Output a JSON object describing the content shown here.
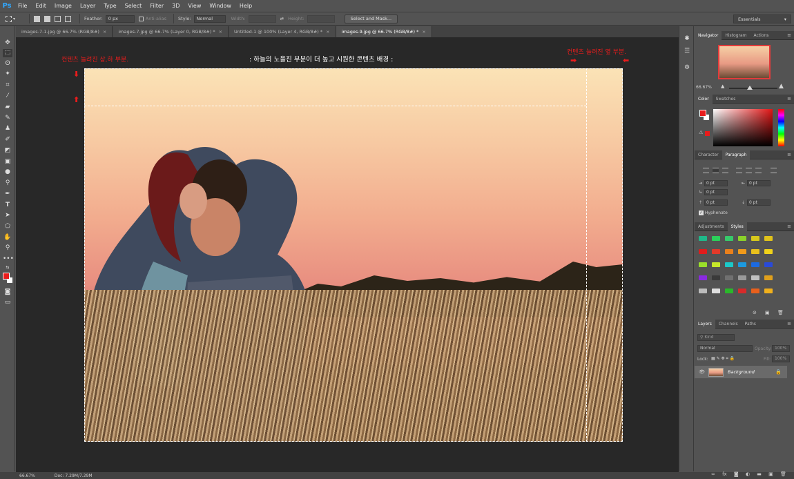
{
  "menu": {
    "logo": "Ps",
    "items": [
      "File",
      "Edit",
      "Image",
      "Layer",
      "Type",
      "Select",
      "Filter",
      "3D",
      "View",
      "Window",
      "Help"
    ]
  },
  "options": {
    "feather_label": "Feather:",
    "feather_value": "0 px",
    "antialias_label": "Anti-alias",
    "style_label": "Style:",
    "style_value": "Normal",
    "width_label": "Width:",
    "height_label": "Height:",
    "select_mask_label": "Select and Mask...",
    "workspace": "Essentials"
  },
  "tabs": [
    {
      "label": "images-7-1.jpg @ 66.7% (RGB/8#)",
      "close": "×"
    },
    {
      "label": "images-7.jpg @ 66.7% (Layer 0, RGB/8#) *",
      "close": "×"
    },
    {
      "label": "Untitled-1 @ 100% (Layer 4, RGB/8#) *",
      "close": "×"
    },
    {
      "label": "images-9.jpg @ 66.7% (RGB/8#) *",
      "close": "×"
    }
  ],
  "canvas": {
    "annotation_top_left": "컨텐츠 늘려진 상,하 부분.",
    "annotation_top_right": "컨텐츠 늘려진 옆 부분.",
    "center_note": ": 하늘의 노을진 부분이 더 높고 시원한 콘텐츠 배경 :"
  },
  "status": {
    "zoom": "66.67%",
    "doc": "Doc: 7.29M/7.29M"
  },
  "navigator": {
    "tabs": [
      "Navigator",
      "Histogram",
      "Actions"
    ],
    "zoom": "66.67%"
  },
  "color_panel": {
    "tabs": [
      "Color",
      "Swatches"
    ]
  },
  "paragraph_panel": {
    "tabs": [
      "Character",
      "Paragraph"
    ],
    "fields": [
      "0 pt",
      "0 pt",
      "0 pt",
      "0 pt",
      "0 pt"
    ],
    "hyphenate": "Hyphenate"
  },
  "styles_panel": {
    "tabs": [
      "Adjustments",
      "Styles"
    ]
  },
  "layers_panel": {
    "tabs": [
      "Layers",
      "Channels",
      "Paths"
    ],
    "kind": "Kind",
    "blend": "Normal",
    "opacity_label": "Opacity:",
    "opacity_value": "100%",
    "lock_label": "Lock:",
    "fill_label": "Fill:",
    "fill_value": "100%",
    "layer_name": "Background"
  },
  "colors": {
    "foreground": "#e81c1c",
    "background": "#ffffff",
    "accent_annotation": "#e81c1c",
    "ps_blue": "#31a8ff"
  }
}
